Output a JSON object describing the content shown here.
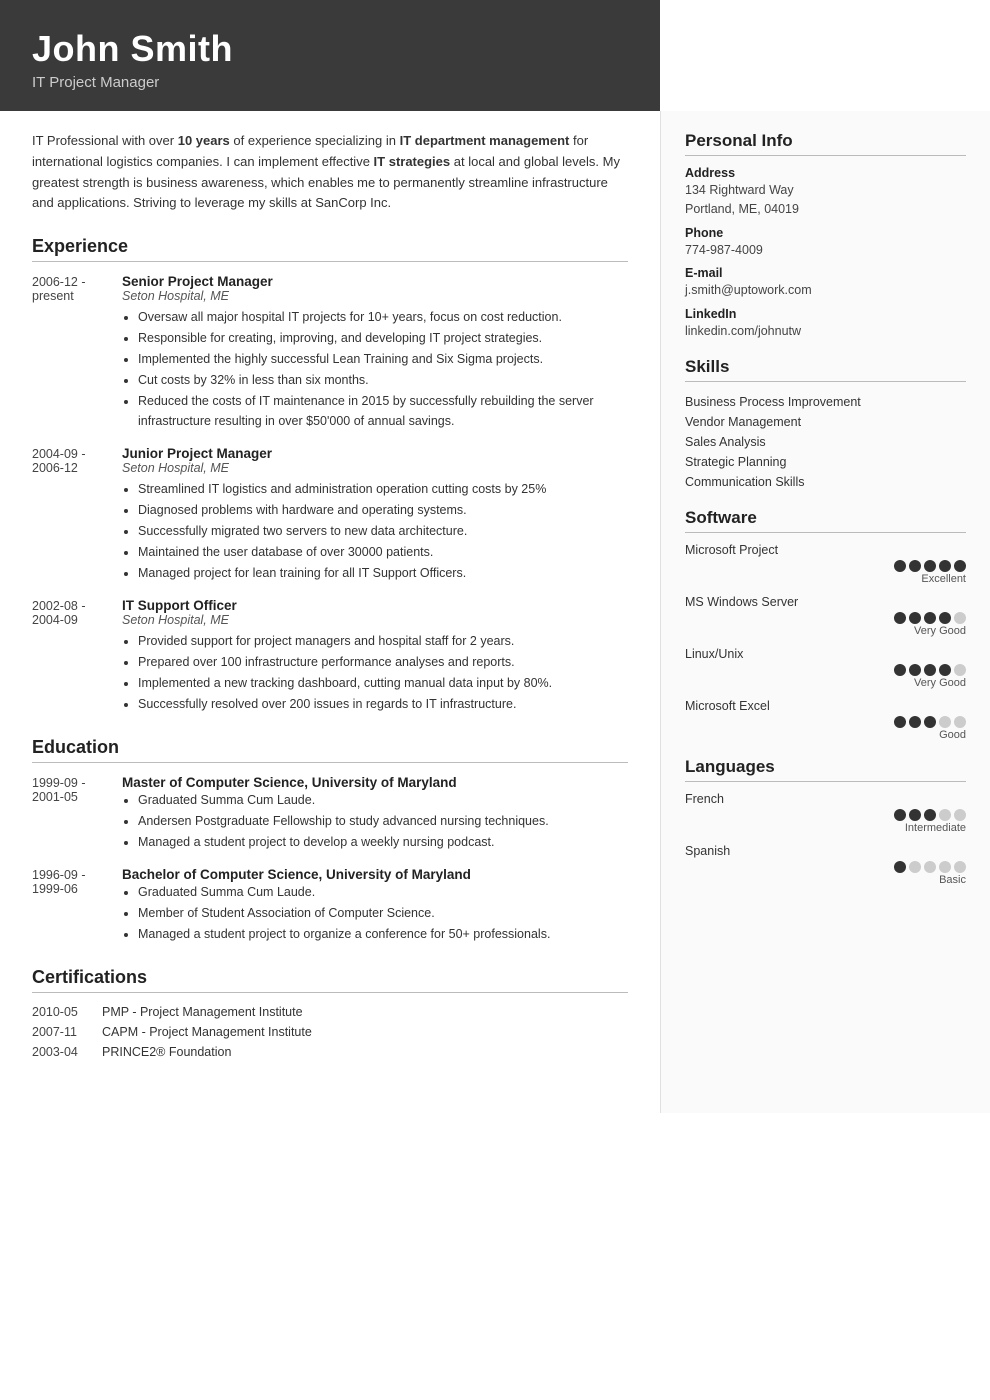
{
  "header": {
    "name": "John Smith",
    "title": "IT Project Manager"
  },
  "summary": "IT Professional with over <b>10 years</b> of experience specializing in <b>IT department management</b> for international logistics companies. I can implement effective <b>IT strategies</b> at local and global levels. My greatest strength is business awareness, which enables me to permanently streamline infrastructure and applications. Striving to leverage my skills at SanCorp Inc.",
  "sections": {
    "experience_title": "Experience",
    "education_title": "Education",
    "certifications_title": "Certifications"
  },
  "experience": [
    {
      "dates_line1": "2006-12 -",
      "dates_line2": "present",
      "title": "Senior Project Manager",
      "org": "Seton Hospital, ME",
      "bullets": [
        "Oversaw all major hospital IT projects for 10+ years, focus on cost reduction.",
        "Responsible for creating, improving, and developing IT project strategies.",
        "Implemented the highly successful Lean Training and Six Sigma projects.",
        "Cut costs by 32% in less than six months.",
        "Reduced the costs of IT maintenance in 2015 by successfully rebuilding the server infrastructure resulting in over $50'000 of annual savings."
      ]
    },
    {
      "dates_line1": "2004-09 -",
      "dates_line2": "2006-12",
      "title": "Junior Project Manager",
      "org": "Seton Hospital, ME",
      "bullets": [
        "Streamlined IT logistics and administration operation cutting costs by 25%",
        "Diagnosed problems with hardware and operating systems.",
        "Successfully migrated two servers to new data architecture.",
        "Maintained the user database of over 30000 patients.",
        "Managed project for lean training for all IT Support Officers."
      ]
    },
    {
      "dates_line1": "2002-08 -",
      "dates_line2": "2004-09",
      "title": "IT Support Officer",
      "org": "Seton Hospital, ME",
      "bullets": [
        "Provided support for project managers and hospital staff for 2 years.",
        "Prepared over 100 infrastructure performance analyses and reports.",
        "Implemented a new tracking dashboard, cutting manual data input by 80%.",
        "Successfully resolved over 200 issues in regards to IT infrastructure."
      ]
    }
  ],
  "education": [
    {
      "dates_line1": "1999-09 -",
      "dates_line2": "2001-05",
      "title": "Master of Computer Science, University of Maryland",
      "org": "",
      "bullets": [
        "Graduated Summa Cum Laude.",
        "Andersen Postgraduate Fellowship to study advanced nursing techniques.",
        "Managed a student project to develop a weekly nursing podcast."
      ]
    },
    {
      "dates_line1": "1996-09 -",
      "dates_line2": "1999-06",
      "title": "Bachelor of Computer Science, University of Maryland",
      "org": "",
      "bullets": [
        "Graduated Summa Cum Laude.",
        "Member of Student Association of Computer Science.",
        "Managed a student project to organize a conference for 50+ professionals."
      ]
    }
  ],
  "certifications": [
    {
      "date": "2010-05",
      "name": "PMP - Project Management Institute"
    },
    {
      "date": "2007-11",
      "name": "CAPM - Project Management Institute"
    },
    {
      "date": "2003-04",
      "name": "PRINCE2® Foundation"
    }
  ],
  "personal_info": {
    "section_title": "Personal Info",
    "address_label": "Address",
    "address_value": "134 Rightward Way\nPortland, ME, 04019",
    "phone_label": "Phone",
    "phone_value": "774-987-4009",
    "email_label": "E-mail",
    "email_value": "j.smith@uptowork.com",
    "linkedin_label": "LinkedIn",
    "linkedin_value": "linkedin.com/johnutw"
  },
  "skills": {
    "section_title": "Skills",
    "items": [
      "Business Process Improvement",
      "Vendor Management",
      "Sales Analysis",
      "Strategic Planning",
      "Communication Skills"
    ]
  },
  "software": {
    "section_title": "Software",
    "items": [
      {
        "name": "Microsoft Project",
        "filled": 5,
        "total": 5,
        "label": "Excellent"
      },
      {
        "name": "MS Windows Server",
        "filled": 4,
        "total": 5,
        "label": "Very Good"
      },
      {
        "name": "Linux/Unix",
        "filled": 4,
        "total": 5,
        "label": "Very Good"
      },
      {
        "name": "Microsoft Excel",
        "filled": 3,
        "total": 5,
        "label": "Good"
      }
    ]
  },
  "languages": {
    "section_title": "Languages",
    "items": [
      {
        "name": "French",
        "filled": 3,
        "total": 5,
        "label": "Intermediate"
      },
      {
        "name": "Spanish",
        "filled": 1,
        "total": 5,
        "label": "Basic"
      }
    ]
  }
}
